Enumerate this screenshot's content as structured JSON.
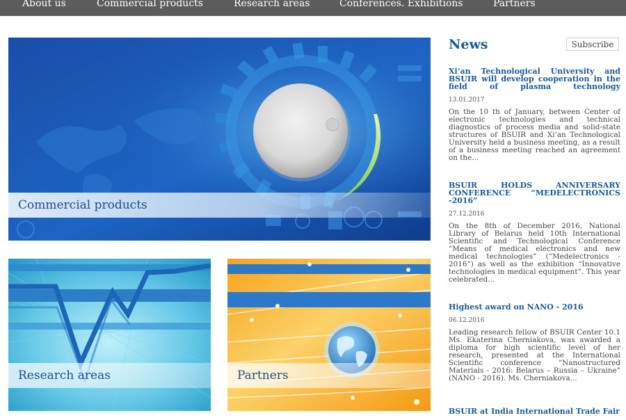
{
  "nav": {
    "items": [
      "About us",
      "Commercial products",
      "Research areas",
      "Conferences. Exhibitions",
      "Partners"
    ]
  },
  "tiles": {
    "commercial": "Commercial products",
    "research": "Research areas",
    "partners": "Partners"
  },
  "news": {
    "heading": "News",
    "subscribe_label": "Subscribe",
    "items": [
      {
        "title": "Xi’an Technological University and BSUIR will develop cooperation in the field of plasma technology",
        "date": "13.01.2017",
        "text": "On the 10 th of January, between Center of electronic technologies and technical diagnostics of process media and solid-state structures of BSUIR and Xi’an Technological University held a business meeting, as a result of a business meeting reached an agreement  on the..."
      },
      {
        "title": "BSUIR HOLDS ANNIVERSARY CONFERENCE “MEDELECTRONICS -2016”",
        "date": "27.12.2016",
        "text": "On the 8th of December 2016, National Library of Belarus held 10th International Scientific and Technological Conference “Means of medical electronics and new medical technologies” (“Medelectronics - 2016”) as well as the exhibition “Innovative technologies in medical equipment”. This year celebrated..."
      },
      {
        "title": "Highest award on NANO - 2016",
        "date": "06.12.2016",
        "text": "Leading research fellow of BSUIR Center 10.1 Ms. Ekaterina Cherniakova, was awarded a diploma for high scientific level of her research, presented at the International Scientific conference “Nanostructured Materials - 2016: Belarus – Russia – Ukraine” (NANO - 2016). Ms. Cherniakova..."
      },
      {
        "title": "BSUIR at India International Trade Fair",
        "date": "",
        "text": ""
      }
    ]
  },
  "colors": {
    "nav_bg": "#5c5c5c",
    "link_blue": "#1a5a96",
    "label_blue": "#1f4e8c"
  }
}
